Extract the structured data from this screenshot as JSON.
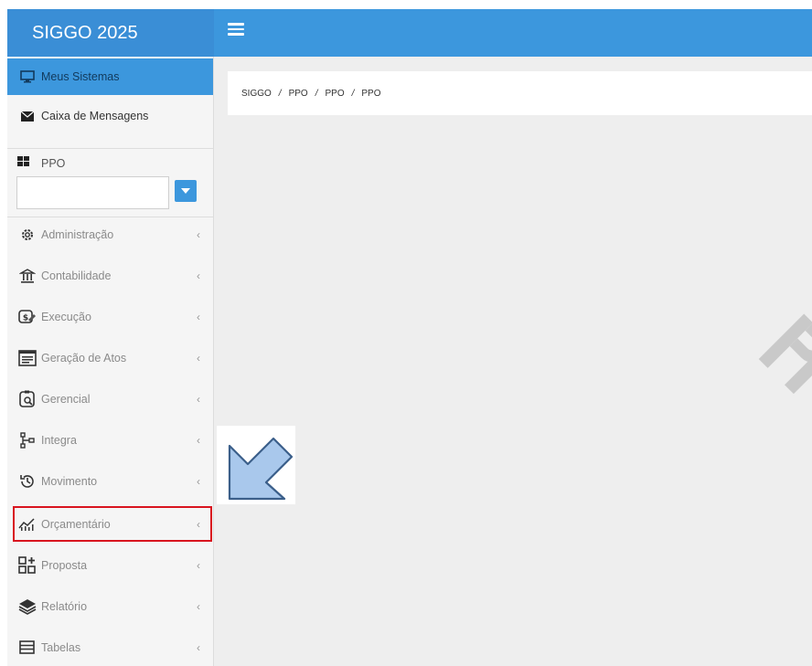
{
  "app": {
    "title": "SIGGO 2025"
  },
  "sidebar": {
    "top_items": [
      {
        "label": "Meus Sistemas",
        "icon": "monitor-icon"
      },
      {
        "label": "Caixa de Mensagens",
        "icon": "envelope-icon"
      }
    ],
    "system": {
      "label": "PPO",
      "select_value": ""
    },
    "menu": [
      {
        "label": "Administração",
        "icon": "gear-group-icon"
      },
      {
        "label": "Contabilidade",
        "icon": "bank-icon"
      },
      {
        "label": "Execução",
        "icon": "money-icon"
      },
      {
        "label": "Geração de Atos",
        "icon": "document-list-icon"
      },
      {
        "label": "Gerencial",
        "icon": "report-search-icon"
      },
      {
        "label": "Integra",
        "icon": "hierarchy-icon"
      },
      {
        "label": "Movimento",
        "icon": "history-icon"
      },
      {
        "label": "Orçamentário",
        "icon": "chart-growth-icon"
      },
      {
        "label": "Proposta",
        "icon": "grid-plus-icon"
      },
      {
        "label": "Relatório",
        "icon": "layers-icon"
      },
      {
        "label": "Tabelas",
        "icon": "table-icon"
      }
    ]
  },
  "breadcrumb": [
    "SIGGO",
    "PPO",
    "PPO",
    "PPO"
  ],
  "colors": {
    "accent": "#3c97dd",
    "highlight": "#d9141f"
  }
}
